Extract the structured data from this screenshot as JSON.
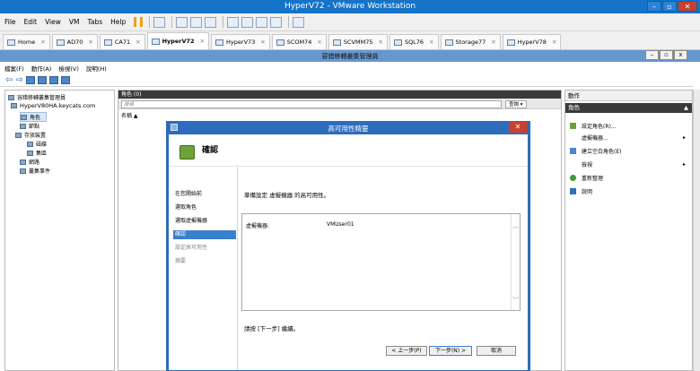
{
  "vmware": {
    "title": "HyperV72 - VMware Workstation",
    "menu": [
      "File",
      "Edit",
      "View",
      "VM",
      "Tabs",
      "Help"
    ],
    "tabs": [
      {
        "label": "Home",
        "active": false
      },
      {
        "label": "AD70",
        "active": false
      },
      {
        "label": "CA71",
        "active": false
      },
      {
        "label": "HyperV72",
        "active": true
      },
      {
        "label": "HyperV73",
        "active": false
      },
      {
        "label": "SCOM74",
        "active": false
      },
      {
        "label": "SCVMM75",
        "active": false
      },
      {
        "label": "SQL76",
        "active": false
      },
      {
        "label": "Storage77",
        "active": false
      },
      {
        "label": "HyperV78",
        "active": false
      }
    ]
  },
  "mmc": {
    "title": "容錯移轉叢集管理員",
    "menu": [
      "檔案(F)",
      "動作(A)",
      "檢視(V)",
      "說明(H)"
    ],
    "tree": {
      "root": "容錯移轉叢集管理員",
      "cluster": "HyperV80HA.keycats.com",
      "roles": "角色",
      "nodes": "節點",
      "storage": "存放裝置",
      "disks": "磁碟",
      "pools": "集區",
      "networks": "網路",
      "events": "叢集事件"
    },
    "center": {
      "header": "角色 (0)",
      "search_placeholder": "搜尋",
      "query_button": "查詢",
      "column_name": "名稱"
    },
    "actions": {
      "header": "動作",
      "section": "角色",
      "items": [
        {
          "label": "設定角色(R)...",
          "submenu": false
        },
        {
          "label": "虛擬機器...",
          "submenu": true
        },
        {
          "label": "建立空白角色(E)",
          "submenu": false
        },
        {
          "label": "檢視",
          "submenu": true
        },
        {
          "label": "重新整理",
          "submenu": false
        },
        {
          "label": "說明",
          "submenu": false
        }
      ]
    }
  },
  "dialog": {
    "title": "高可用性精靈",
    "heading": "確認",
    "steps": [
      {
        "label": "在您開始前",
        "state": "done"
      },
      {
        "label": "選取角色",
        "state": "done"
      },
      {
        "label": "選取虛擬機器",
        "state": "done"
      },
      {
        "label": "確認",
        "state": "current"
      },
      {
        "label": "設定高可用性",
        "state": "pending"
      },
      {
        "label": "摘要",
        "state": "pending"
      }
    ],
    "intro": "準備設定 虛擬機器 的高可用性。",
    "field_label": "虛擬機器:",
    "field_value": "VMUser01",
    "next_hint": "請按 [下一步] 繼續。",
    "buttons": {
      "back": "< 上一步(P)",
      "next": "下一步(N) >",
      "cancel": "取消"
    }
  },
  "colors": {
    "vmware_title": "#1573c8",
    "mmc_title": "#6797cd",
    "dialog_frame": "#2e6cbd",
    "selected_step": "#3b80cf",
    "dark_header": "#3a3a3a",
    "close_red": "#c9412d"
  }
}
